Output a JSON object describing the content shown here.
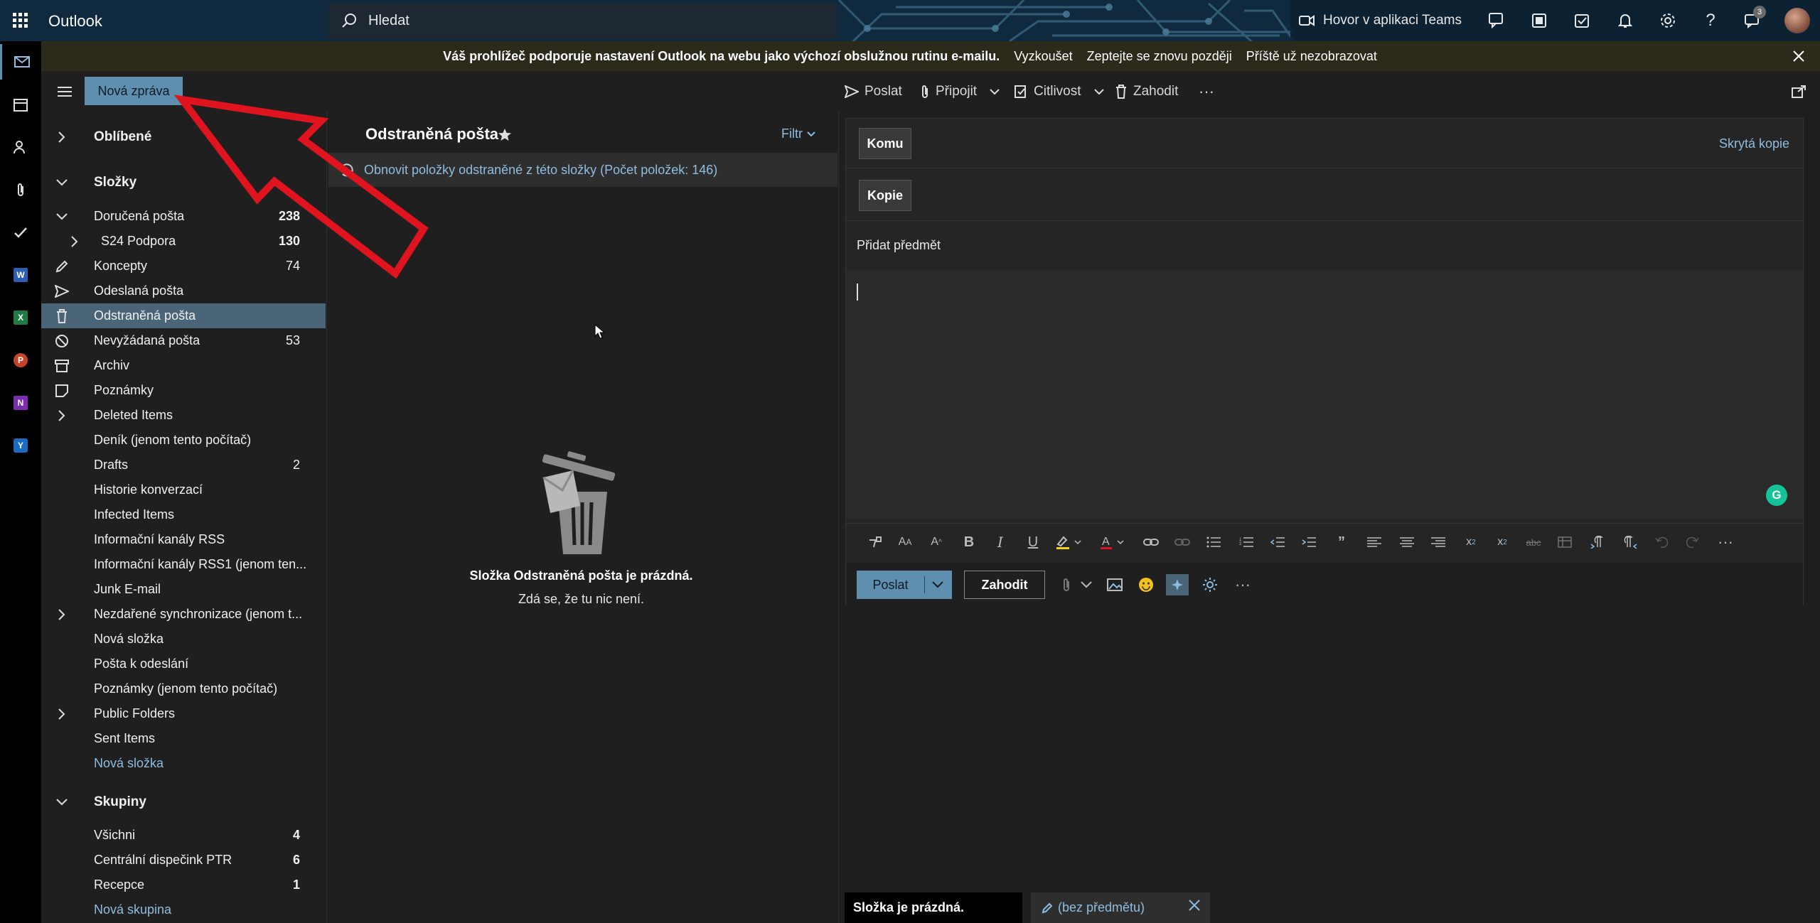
{
  "app": {
    "title": "Outlook"
  },
  "search": {
    "placeholder": "Hledat"
  },
  "topbar": {
    "teams_call_label": "Hovor v aplikaci Teams",
    "notifications_badge": "3"
  },
  "notice": {
    "message": "Váš prohlížeč podporuje nastavení Outlook na webu jako výchozí obslužnou rutinu e-mailu.",
    "actions": [
      "Vyzkoušet",
      "Zeptejte se znovu později",
      "Příště už nezobrazovat"
    ]
  },
  "toolbar": {
    "new_message_label": "Nová zpráva",
    "send_label": "Poslat",
    "attach_label": "Připojit",
    "sensitivity_label": "Citlivost",
    "discard_label": "Zahodit"
  },
  "folders": {
    "favorites_label": "Oblíbené",
    "folders_label": "Složky",
    "items": [
      {
        "label": "Doručená pošta",
        "count": "238"
      },
      {
        "label": "S24 Podpora",
        "count": "130"
      },
      {
        "label": "Koncepty",
        "count": "74"
      },
      {
        "label": "Odeslaná pošta",
        "count": ""
      },
      {
        "label": "Odstraněná pošta",
        "count": ""
      },
      {
        "label": "Nevyžádaná pošta",
        "count": "53"
      },
      {
        "label": "Archiv",
        "count": ""
      },
      {
        "label": "Poznámky",
        "count": ""
      },
      {
        "label": "Deleted Items",
        "count": ""
      },
      {
        "label": "Deník (jenom tento počítač)",
        "count": ""
      },
      {
        "label": "Drafts",
        "count": "2"
      },
      {
        "label": "Historie konverzací",
        "count": ""
      },
      {
        "label": "Infected Items",
        "count": ""
      },
      {
        "label": "Informační kanály RSS",
        "count": ""
      },
      {
        "label": "Informační kanály RSS1 (jenom ten...",
        "count": ""
      },
      {
        "label": "Junk E-mail",
        "count": ""
      },
      {
        "label": "Nezdařené synchronizace (jenom t...",
        "count": ""
      },
      {
        "label": "Nová složka",
        "count": ""
      },
      {
        "label": "Pošta k odeslání",
        "count": ""
      },
      {
        "label": "Poznámky (jenom tento počítač)",
        "count": ""
      },
      {
        "label": "Public Folders",
        "count": ""
      },
      {
        "label": "Sent Items",
        "count": ""
      },
      {
        "label": "Nová složka",
        "count": ""
      }
    ],
    "groups_label": "Skupiny",
    "groups": [
      {
        "label": "Všichni",
        "count": "4"
      },
      {
        "label": "Centrální dispečink PTR",
        "count": "6"
      },
      {
        "label": "Recepce",
        "count": "1"
      },
      {
        "label": "Nová skupina",
        "count": ""
      }
    ]
  },
  "list": {
    "title": "Odstraněná pošta",
    "filter_label": "Filtr",
    "recover_text": "Obnovit položky odstraněné z této složky (Počet položek: 146)",
    "empty_title": "Složka Odstraněná pošta je prázdná.",
    "empty_subtitle": "Zdá se, že tu nic není."
  },
  "compose": {
    "to_label": "Komu",
    "cc_label": "Kopie",
    "bcc_label": "Skrytá kopie",
    "subject_placeholder": "Přidat předmět",
    "send_label": "Poslat",
    "discard_label": "Zahodit"
  },
  "bottom": {
    "status_text": "Složka je prázdná.",
    "draft_tab_label": "(bez předmětu)"
  },
  "colors": {
    "accent": "#5f8fae",
    "link": "#8fbde0",
    "selected": "#4a6578",
    "arrow": "#e0141e"
  }
}
